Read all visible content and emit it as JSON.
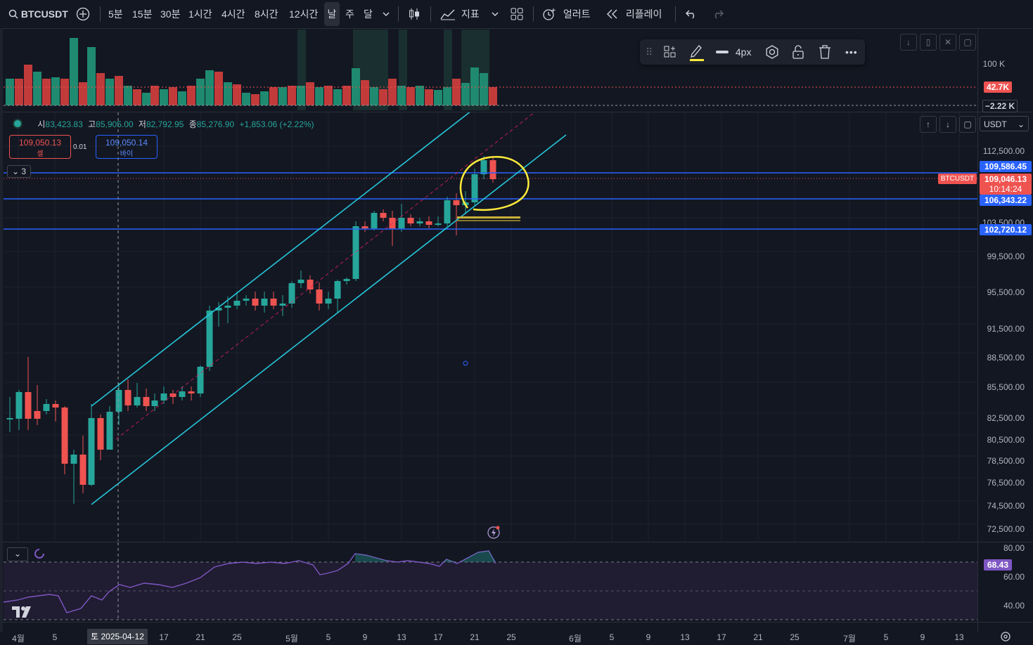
{
  "toolbar": {
    "symbol": "BTCUSDT",
    "intervals": [
      "5분",
      "15분",
      "30분",
      "1시간",
      "4시간",
      "8시간",
      "12시간",
      "날",
      "주",
      "달"
    ],
    "active_interval": "날",
    "indicators_label": "지표",
    "alert_label": "얼러트",
    "replay_label": "리플레이"
  },
  "legend": {
    "open_key": "시",
    "open": "83,423.83",
    "high_key": "고",
    "high": "85,905.00",
    "low_key": "저",
    "low": "82,792.95",
    "close_key": "종",
    "close": "85,276.90",
    "change": "+1,853.06 (+2.22%)"
  },
  "order": {
    "sell_price": "109,050.13",
    "sell_label": "셀",
    "spread": "0.01",
    "buy_price": "109,050.14",
    "buy_label": "바이"
  },
  "collapse_count": "3",
  "drawbar": {
    "width_label": "4px"
  },
  "currency": "USDT",
  "volume_axis": {
    "label": "100 K",
    "tag_volume": "42.7K",
    "tag_ma": "−2.22 K"
  },
  "price_axis": {
    "labels": [
      "112,500.00",
      "103,500.00",
      "99,500.00",
      "95,500.00",
      "91,500.00",
      "88,500.00",
      "85,500.00",
      "82,500.00",
      "80,500.00",
      "78,500.00",
      "76,500.00",
      "74,500.00",
      "72,500.00"
    ],
    "level_1": "109,586.45",
    "level_2": "106,343.22",
    "level_3": "102,720.12",
    "last_price": "109,046.13",
    "countdown": "10:14:24",
    "symbol_tag": "BTCUSDT"
  },
  "rsi_axis": {
    "labels": [
      "80.00",
      "60.00",
      "40.00"
    ],
    "value": "68.43"
  },
  "time_axis": {
    "labels": [
      "4월",
      "5",
      "17",
      "21",
      "25",
      "5월",
      "5",
      "9",
      "13",
      "17",
      "21",
      "25",
      "6월",
      "5",
      "9",
      "13",
      "17",
      "21",
      "25",
      "7월",
      "5",
      "9",
      "13"
    ],
    "cursor_date": "토 2025-04-12"
  },
  "colors": {
    "up": "#26a69a",
    "down": "#ef5350",
    "channel": "#26c6da",
    "level": "#2962ff",
    "highlight": "#ffeb3b"
  }
}
